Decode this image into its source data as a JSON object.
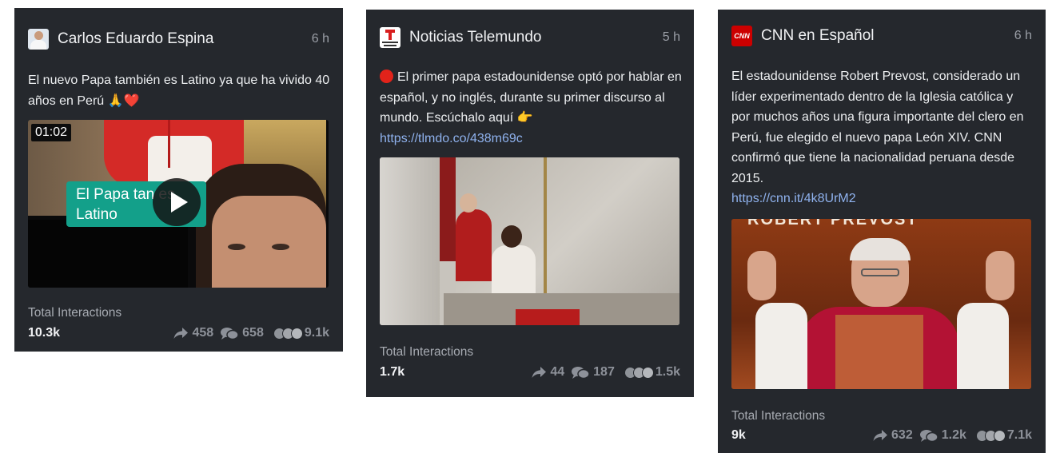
{
  "posts": [
    {
      "author": "Carlos Eduardo Espina",
      "time": "6 h",
      "text": "El nuevo Papa también es Latino ya que ha vivido 40 años en Perú 🙏❤️",
      "video_duration": "01:02",
      "video_caption": "El Papa tan es Latino",
      "label": "Total Interactions",
      "total": "10.3k",
      "shares": "458",
      "comments": "658",
      "reactions": "9.1k"
    },
    {
      "author": "Noticias Telemundo",
      "time": "5 h",
      "text": "El primer papa estadounidense optó por hablar en español, y no inglés, durante su primer discurso al mundo. Escúchalo aquí 👉",
      "link": "https://tlmdo.co/438m69c",
      "label": "Total Interactions",
      "total": "1.7k",
      "shares": "44",
      "comments": "187",
      "reactions": "1.5k"
    },
    {
      "author": "CNN en Español",
      "time": "6 h",
      "text": "El estadounidense Robert Prevost, considerado un líder experimentado dentro de la Iglesia católica y por muchos años una figura importante del clero en Perú, fue elegido el nuevo papa León XIV. CNN confirmó que tiene la nacionalidad peruana desde 2015.",
      "link": "https://cnn.it/4k8UrM2",
      "image_overlay": "ROBERT PREVOST",
      "logo": "CNN",
      "label": "Total Interactions",
      "total": "9k",
      "shares": "632",
      "comments": "1.2k",
      "reactions": "7.1k"
    }
  ],
  "colors": {
    "card_bg": "#25282d",
    "link": "#8fb2ee",
    "muted": "#8d9199"
  },
  "icons": [
    "share-icon",
    "comment-icon",
    "reaction-icons",
    "play-icon"
  ]
}
